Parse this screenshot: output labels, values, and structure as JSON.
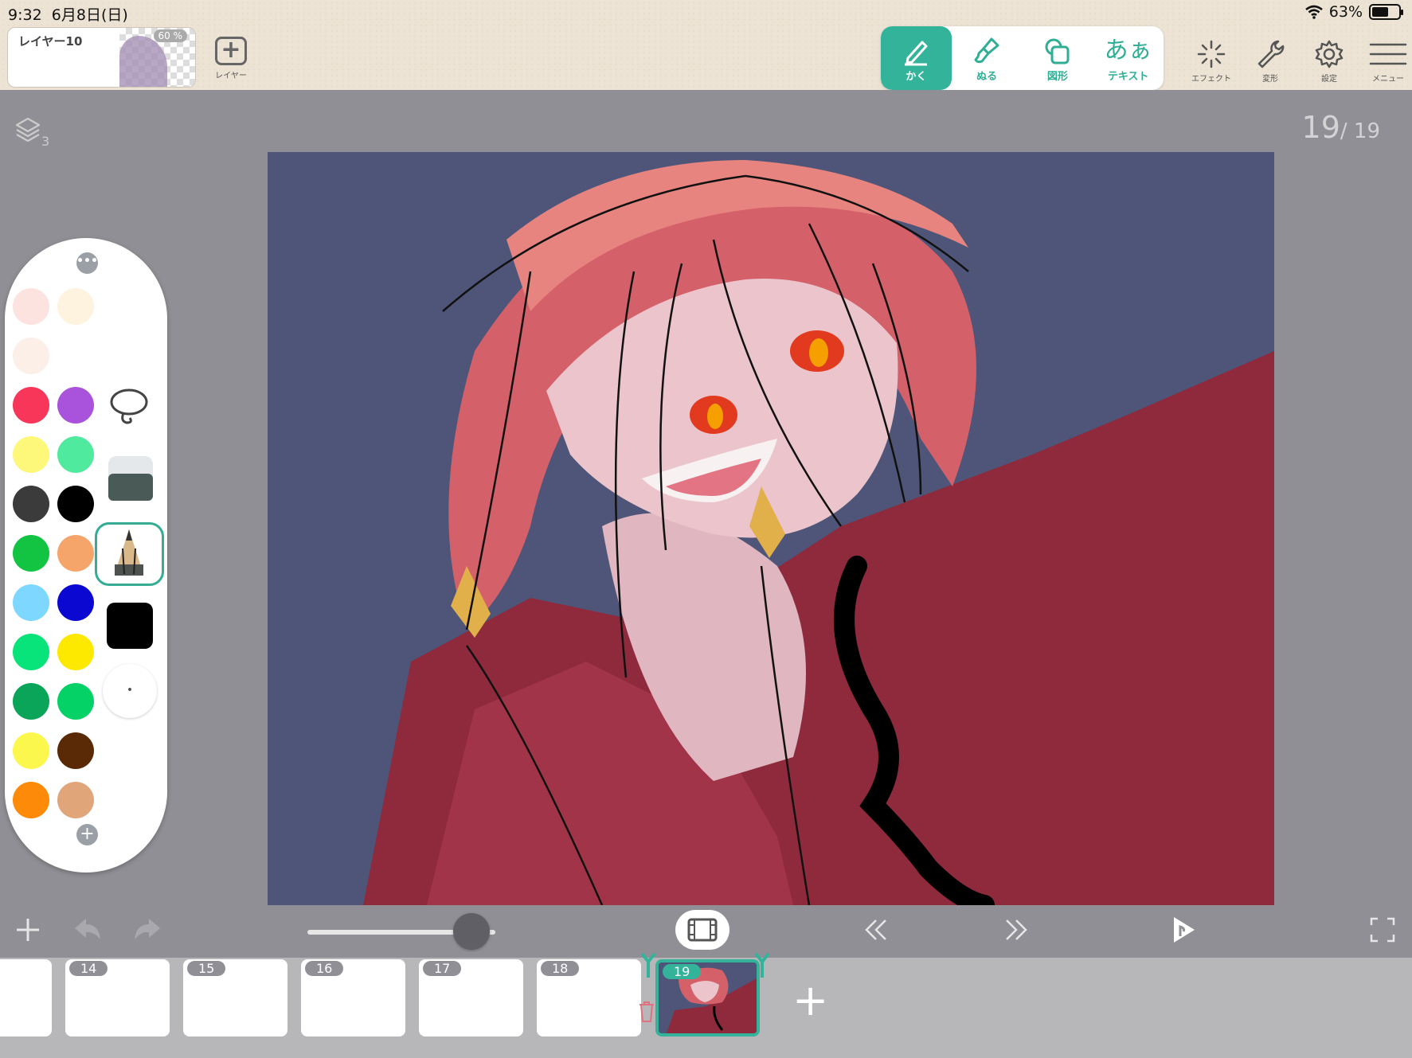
{
  "status": {
    "time": "9:32",
    "date": "6月8日(日)",
    "battery": "63%"
  },
  "layer": {
    "name": "レイヤー10",
    "opacity": "60 %",
    "add_label": "レイヤー"
  },
  "tools": [
    {
      "label": "かく",
      "active": true
    },
    {
      "label": "ぬる"
    },
    {
      "label": "図形"
    },
    {
      "label": "テキスト",
      "glyph": "あぁ"
    }
  ],
  "right_tools": [
    {
      "label": "エフェクト"
    },
    {
      "label": "変形"
    },
    {
      "label": "設定"
    },
    {
      "label": "メニュー"
    }
  ],
  "canvas": {
    "layer_count": "3",
    "frame_current": "19",
    "frame_total": "/ 19"
  },
  "palette": {
    "more_label": "•••",
    "add_label": "+",
    "colors": [
      "#fde3df",
      "#fdf3de",
      "#fcefe7",
      "#ffffff",
      "#f7365a",
      "#a952dc",
      "#fdf77a",
      "#50ea9e",
      "#3b3b3b",
      "#000000",
      "#13c443",
      "#f5a46a",
      "#7dd7ff",
      "#0a08d1",
      "#08e37a",
      "#fde800",
      "#0ba55a",
      "#04d266",
      "#fcf74c",
      "#5a2a06",
      "#fd8a08",
      "#e0a67a"
    ],
    "brush_size_label": "•"
  },
  "bottom": {
    "add_label": "+"
  },
  "frames": [
    {
      "num": ""
    },
    {
      "num": "14"
    },
    {
      "num": "15"
    },
    {
      "num": "16"
    },
    {
      "num": "17"
    },
    {
      "num": "18"
    },
    {
      "num": "19",
      "current": true
    }
  ],
  "add_frame_label": "+"
}
